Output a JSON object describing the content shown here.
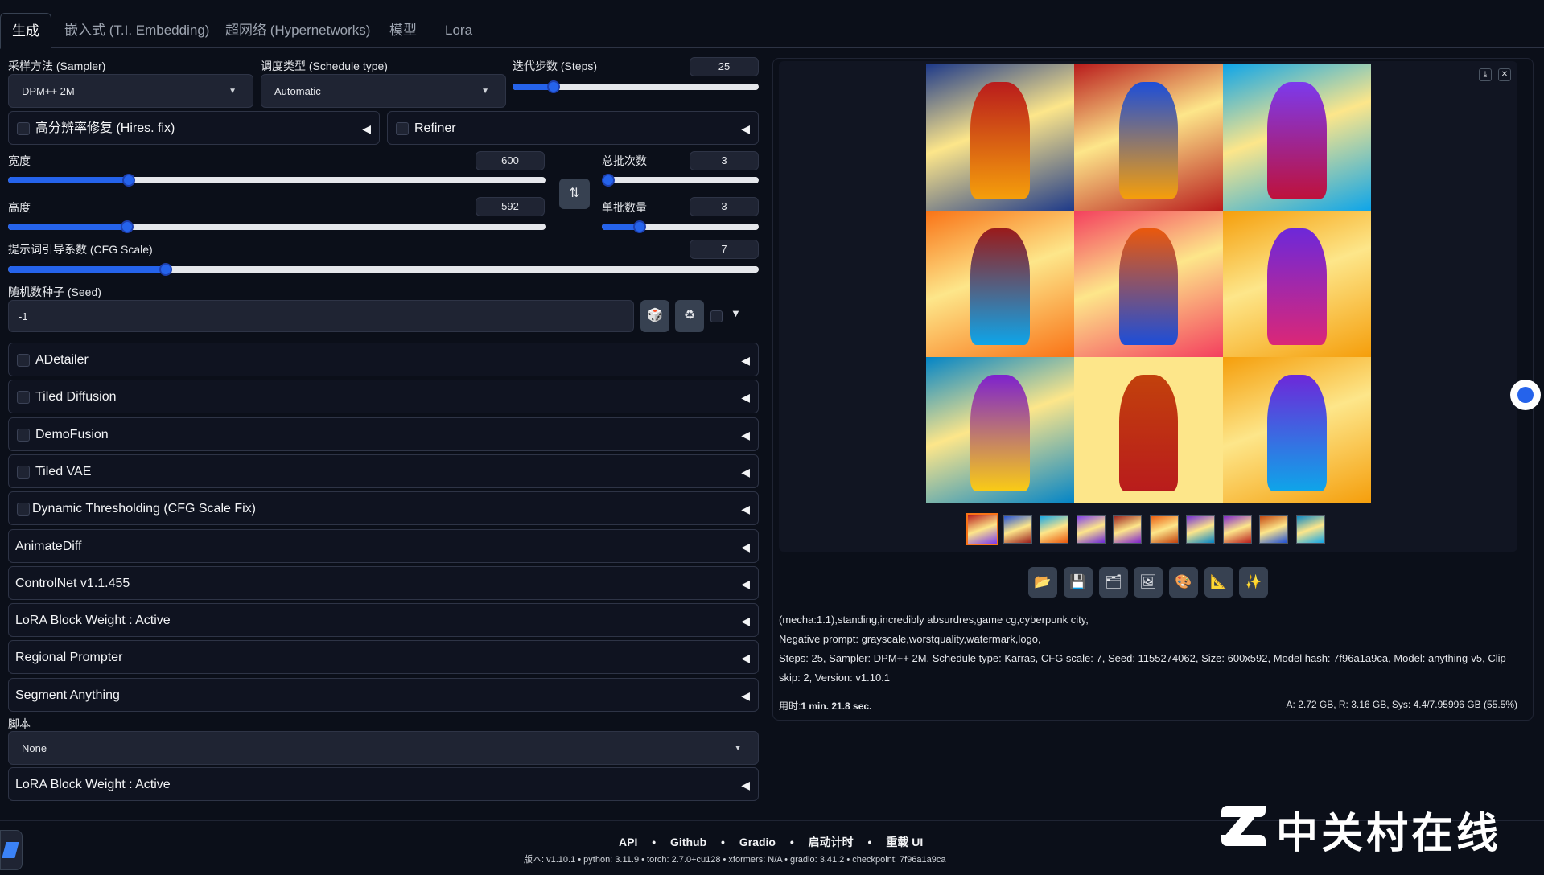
{
  "tabs": [
    "生成",
    "嵌入式 (T.I. Embedding)",
    "超网络 (Hypernetworks)",
    "模型",
    "Lora"
  ],
  "sampler": {
    "label": "采样方法 (Sampler)",
    "value": "DPM++ 2M"
  },
  "schedule": {
    "label": "调度类型 (Schedule type)",
    "value": "Automatic"
  },
  "steps": {
    "label": "迭代步数 (Steps)",
    "value": "25",
    "fraction": 0.167
  },
  "hires": {
    "label": "高分辨率修复 (Hires. fix)"
  },
  "refiner": {
    "label": "Refiner"
  },
  "width": {
    "label": "宽度",
    "value": "600",
    "fraction": 0.275
  },
  "height": {
    "label": "高度",
    "value": "592",
    "fraction": 0.271
  },
  "batch_count": {
    "label": "总批次数",
    "value": "3",
    "fraction": 0.02
  },
  "batch_size": {
    "label": "单批数量",
    "value": "3",
    "fraction": 0.3
  },
  "cfg": {
    "label": "提示词引导系数 (CFG Scale)",
    "value": "7",
    "fraction": 0.21
  },
  "seed": {
    "label": "随机数种子 (Seed)",
    "value": "-1",
    "dice_icon": "🎲",
    "recycle_icon": "♻"
  },
  "accordions": [
    {
      "label": "ADetailer",
      "checkbox": true
    },
    {
      "label": "Tiled Diffusion",
      "checkbox": true
    },
    {
      "label": "DemoFusion",
      "checkbox": true
    },
    {
      "label": "Tiled VAE",
      "checkbox": true
    },
    {
      "label": "Dynamic Thresholding (CFG Scale Fix)",
      "checkbox": true
    },
    {
      "label": "AnimateDiff",
      "checkbox": false
    },
    {
      "label": "ControlNet v1.1.455",
      "checkbox": false
    },
    {
      "label": "LoRA Block Weight : Active",
      "checkbox": false
    },
    {
      "label": "Regional Prompter",
      "checkbox": false
    },
    {
      "label": "Segment Anything",
      "checkbox": false
    }
  ],
  "script": {
    "label": "脚本",
    "value": "None"
  },
  "last_accordion": {
    "label": "LoRA Block Weight : Active"
  },
  "output": {
    "prompt": "(mecha:1.1),standing,incredibly absurdres,game cg,cyberpunk city,",
    "negative": "Negative prompt: grayscale,worstquality,watermark,logo,",
    "params1": "Steps: 25, Sampler: DPM++ 2M, Schedule type: Karras, CFG scale: 7, Seed: 1155274062, Size: 600x592, Model hash: 7f96a1a9ca, Model: anything-v5, Clip",
    "params2": "skip: 2, Version: v1.10.1",
    "time_label": "用时:",
    "time_value": "1 min. 21.8 sec.",
    "mem": "A: 2.72 GB, R: 3.16 GB, Sys: 4.4/7.95996 GB (55.5%)"
  },
  "tools": [
    "📂",
    "💾",
    "🗂",
    "🖼",
    "🎨",
    "📐",
    "✨"
  ],
  "footer": {
    "links": [
      "API",
      "Github",
      "Gradio",
      "启动计时",
      "重载 UI"
    ],
    "version": "版本: v1.10.1  •  python: 3.11.9  •  torch: 2.7.0+cu128  •  xformers: N/A  •  gradio: 3.41.2  •  checkpoint: 7f96a1a9ca"
  },
  "watermark": "中关村在线",
  "colors": {
    "accent": "#2563eb",
    "bg": "#0b0f19",
    "panel": "#1f2433"
  }
}
